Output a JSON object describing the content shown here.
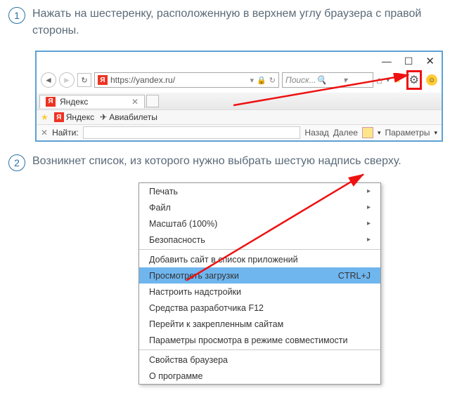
{
  "step1": {
    "num": "1",
    "text": "Нажать на шестеренку, расположенную в верхнем углу браузера с правой стороны."
  },
  "step2": {
    "num": "2",
    "text": "Возникнет список, из которого нужно выбрать шестую надпись сверху."
  },
  "browser": {
    "url": "https://yandex.ru/",
    "search_placeholder": "Поиск...",
    "tab_title": "Яндекс",
    "bookmarks": {
      "yandex": "Яндекс",
      "avia": "Авиабилеты"
    },
    "findbar": {
      "label": "Найти:",
      "back": "Назад",
      "next": "Далее",
      "params": "Параметры"
    }
  },
  "menu": {
    "print": "Печать",
    "file": "Файл",
    "zoom": "Масштаб (100%)",
    "safety": "Безопасность",
    "add_site": "Добавить сайт в список приложений",
    "downloads": "Просмотреть загрузки",
    "downloads_shortcut": "CTRL+J",
    "addons": "Настроить надстройки",
    "devtools": "Средства разработчика F12",
    "pinned": "Перейти к закрепленным сайтам",
    "compat": "Параметры просмотра в режиме совместимости",
    "props": "Свойства браузера",
    "about": "О программе"
  }
}
